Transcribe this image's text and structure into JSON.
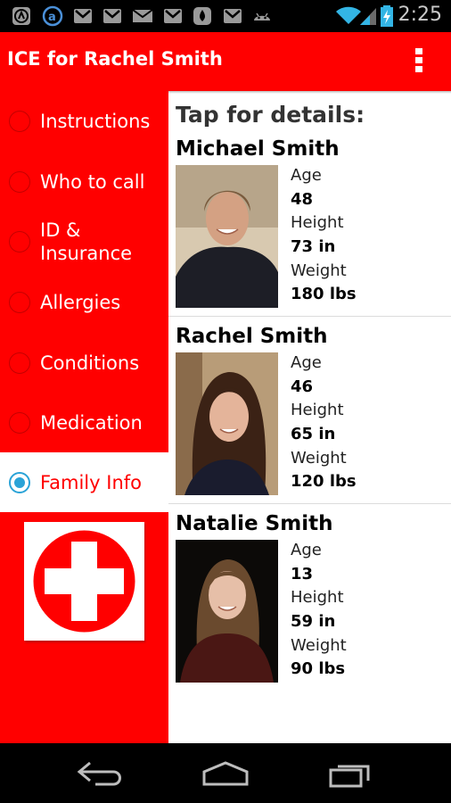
{
  "status_bar": {
    "time": "2:25",
    "notification_icons": [
      "avatar-icon",
      "a-icon",
      "gmail-icon",
      "gmail-icon",
      "email-icon",
      "gmail-icon",
      "gallery-icon",
      "gmail-icon",
      "android-icon"
    ],
    "status_icons": [
      "wifi-icon",
      "signal-icon",
      "battery-charging-icon"
    ]
  },
  "action_bar": {
    "title": "ICE for Rachel Smith",
    "overflow_icon": "overflow-menu-icon",
    "color": "#ff0000"
  },
  "sidebar": {
    "items": [
      {
        "label": "Instructions",
        "selected": false
      },
      {
        "label": "Who to call",
        "selected": false
      },
      {
        "label": "ID & Insurance",
        "selected": false
      },
      {
        "label": "Allergies",
        "selected": false
      },
      {
        "label": "Conditions",
        "selected": false
      },
      {
        "label": "Medication",
        "selected": false
      },
      {
        "label": "Family Info",
        "selected": true
      }
    ],
    "logo_icon": "red-cross-icon",
    "accent": "#2aa3d7"
  },
  "main": {
    "header": "Tap for details:",
    "people": [
      {
        "name": "Michael Smith",
        "age_label": "Age",
        "age": "48",
        "height_label": "Height",
        "height": "73 in",
        "weight_label": "Weight",
        "weight": "180 lbs"
      },
      {
        "name": "Rachel Smith",
        "age_label": "Age",
        "age": "46",
        "height_label": "Height",
        "height": "65 in",
        "weight_label": "Weight",
        "weight": "120 lbs"
      },
      {
        "name": "Natalie Smith",
        "age_label": "Age",
        "age": "13",
        "height_label": "Height",
        "height": "59 in",
        "weight_label": "Weight",
        "weight": "90 lbs"
      }
    ]
  },
  "nav_bar": {
    "buttons": [
      "back-icon",
      "home-icon",
      "recent-apps-icon"
    ]
  }
}
